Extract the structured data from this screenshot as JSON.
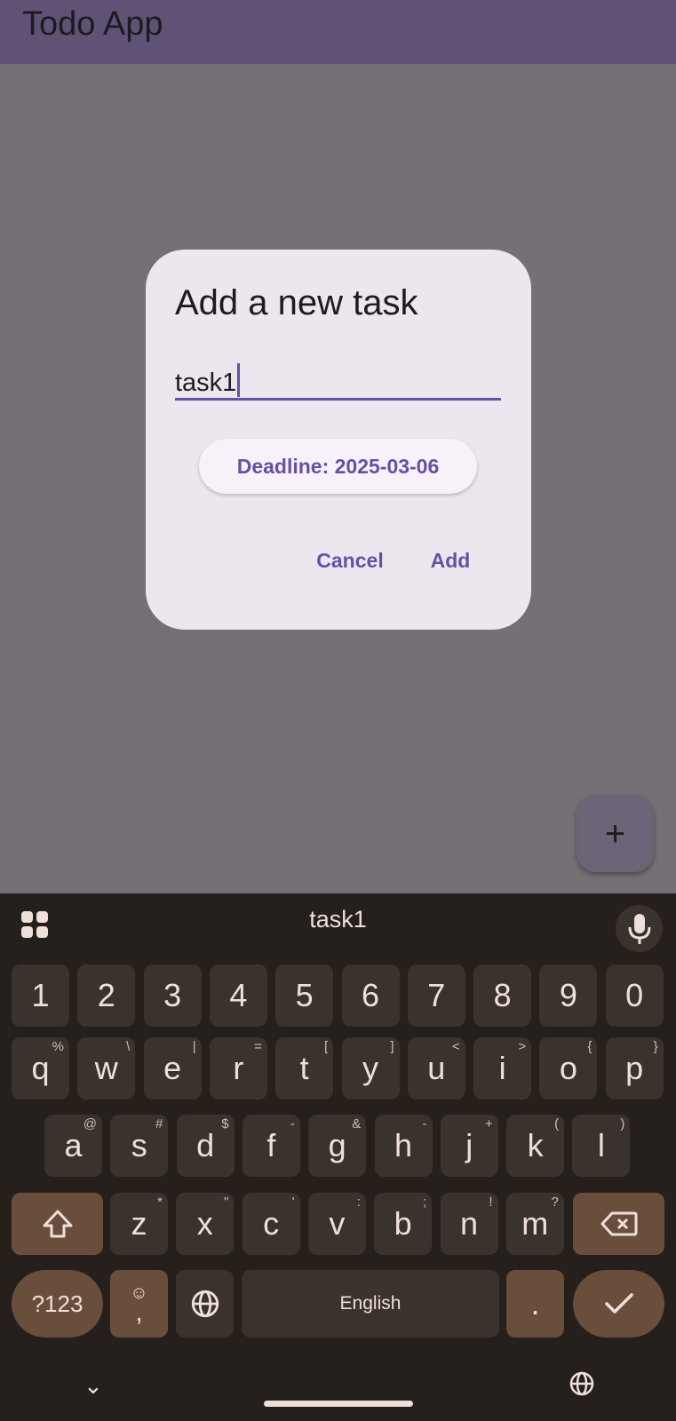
{
  "app": {
    "title": "Todo App"
  },
  "dialog": {
    "title": "Add a new task",
    "task_value": "task1",
    "deadline_label": "Deadline: 2025-03-06",
    "cancel_label": "Cancel",
    "add_label": "Add"
  },
  "fab": {
    "icon": "+",
    "icon_name": "plus-icon"
  },
  "keyboard": {
    "suggestion": "task1",
    "number_row": [
      "1",
      "2",
      "3",
      "4",
      "5",
      "6",
      "7",
      "8",
      "9",
      "0"
    ],
    "row1": [
      {
        "k": "q",
        "h": "%"
      },
      {
        "k": "w",
        "h": "\\"
      },
      {
        "k": "e",
        "h": "|"
      },
      {
        "k": "r",
        "h": "="
      },
      {
        "k": "t",
        "h": "["
      },
      {
        "k": "y",
        "h": "]"
      },
      {
        "k": "u",
        "h": "<"
      },
      {
        "k": "i",
        "h": ">"
      },
      {
        "k": "o",
        "h": "{"
      },
      {
        "k": "p",
        "h": "}"
      }
    ],
    "row2": [
      {
        "k": "a",
        "h": "@"
      },
      {
        "k": "s",
        "h": "#"
      },
      {
        "k": "d",
        "h": "$"
      },
      {
        "k": "f",
        "h": "-"
      },
      {
        "k": "g",
        "h": "&"
      },
      {
        "k": "h",
        "h": "-"
      },
      {
        "k": "j",
        "h": "+"
      },
      {
        "k": "k",
        "h": "("
      },
      {
        "k": "l",
        "h": ")"
      }
    ],
    "row3": [
      {
        "k": "z",
        "h": "*"
      },
      {
        "k": "x",
        "h": "\""
      },
      {
        "k": "c",
        "h": "'"
      },
      {
        "k": "v",
        "h": ":"
      },
      {
        "k": "b",
        "h": ";"
      },
      {
        "k": "n",
        "h": "!"
      },
      {
        "k": "m",
        "h": "?"
      }
    ],
    "symbols_label": "?123",
    "comma_label": ",",
    "space_label": "English",
    "period_label": ".",
    "colors": {
      "key": "#3a322d",
      "modifier": "#6a4e3c",
      "background": "#26201c",
      "text": "#efe0d7"
    }
  },
  "colors": {
    "appbar": "#5f5275",
    "accent": "#6750a4",
    "dialog": "#ece6ef"
  }
}
